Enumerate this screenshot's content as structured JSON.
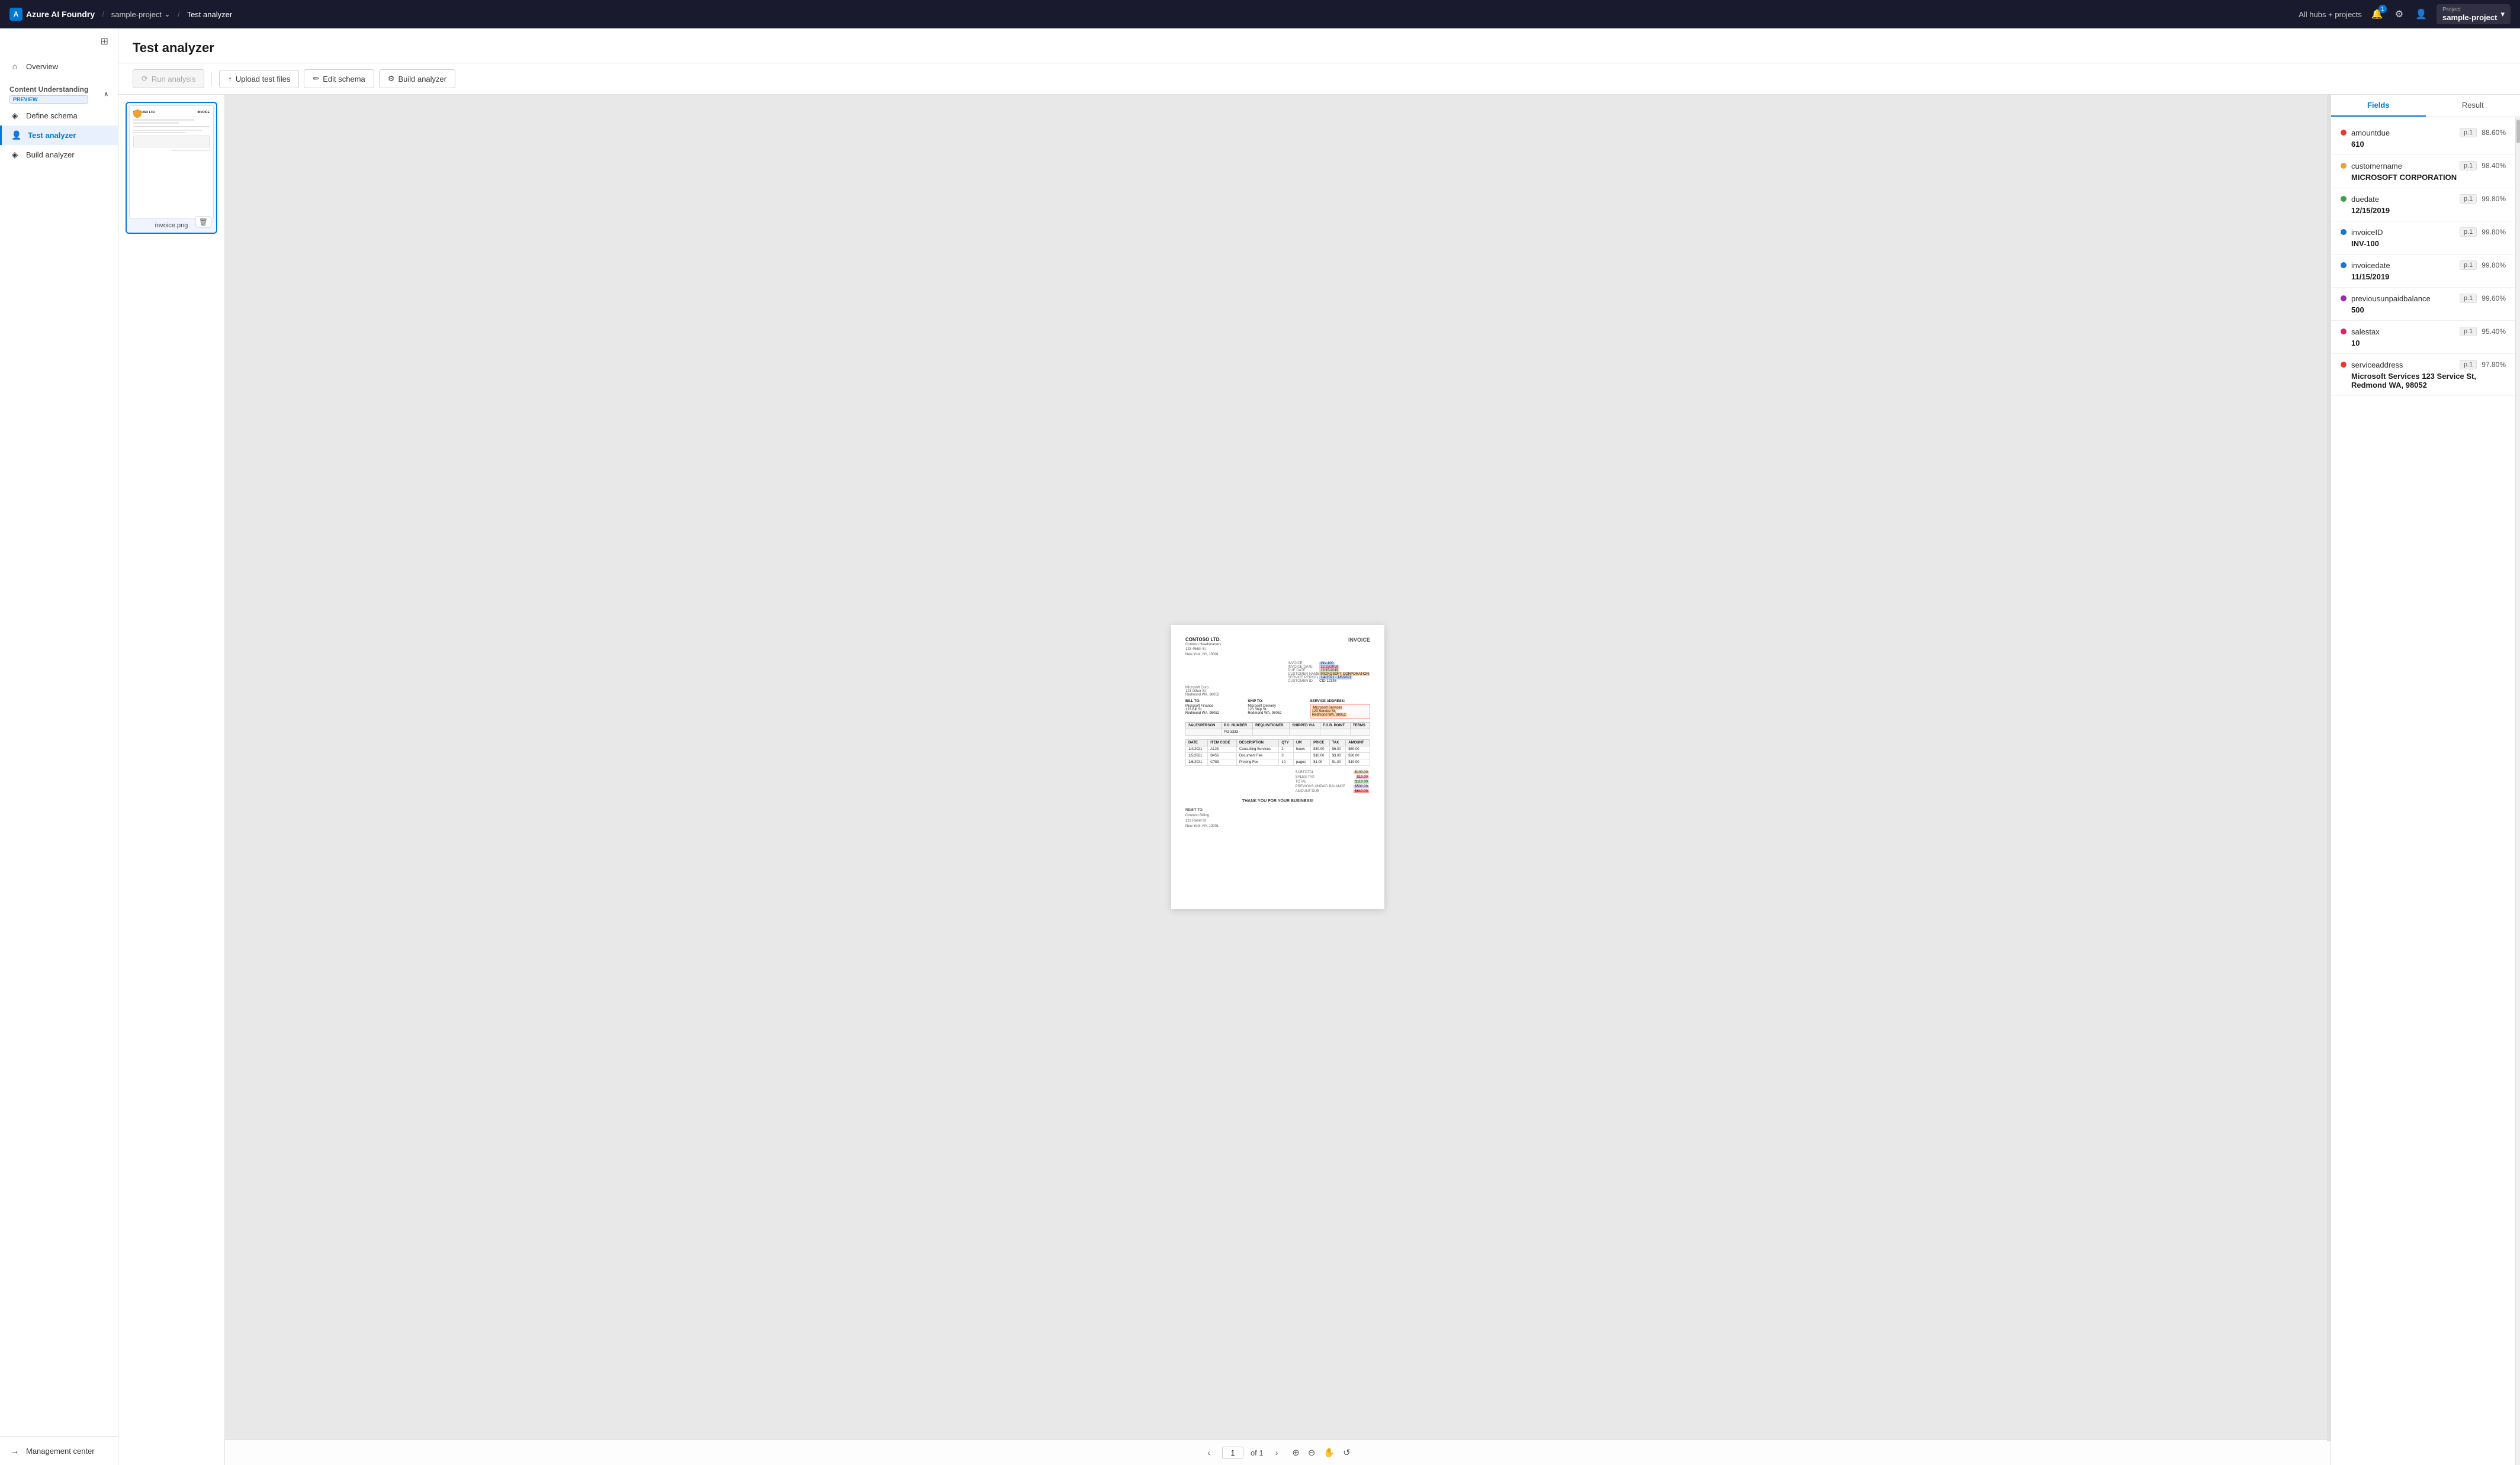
{
  "topnav": {
    "brand": "Azure AI Foundry",
    "brand_icon": "A",
    "project_link": "sample-project",
    "current_page": "Test analyzer",
    "hub_label": "All hubs + projects",
    "project_section_label": "Project",
    "project_name": "sample-project",
    "chevron_icon": "▾"
  },
  "sidebar": {
    "toggle_icon": "⊞",
    "overview_icon": "⌂",
    "overview_label": "Overview",
    "group_label": "Content Understanding",
    "group_preview": "PREVIEW",
    "expand_icon": "∧",
    "items": [
      {
        "id": "define-schema",
        "icon": "◈",
        "label": "Define schema",
        "active": false
      },
      {
        "id": "test-analyzer",
        "icon": "👤",
        "label": "Test analyzer",
        "active": true
      },
      {
        "id": "build-analyzer",
        "icon": "◈",
        "label": "Build analyzer",
        "active": false
      }
    ],
    "management_icon": "→",
    "management_label": "Management center"
  },
  "page": {
    "title": "Test analyzer"
  },
  "toolbar": {
    "run_analysis_label": "Run analysis",
    "run_analysis_icon": "⟳",
    "upload_files_label": "Upload test files",
    "upload_files_icon": "↑",
    "edit_schema_label": "Edit schema",
    "edit_schema_icon": "✏",
    "build_analyzer_label": "Build analyzer",
    "build_analyzer_icon": "⚙"
  },
  "file_panel": {
    "file_name": "invoice.png",
    "delete_icon": "🗑"
  },
  "preview": {
    "page_number": "1",
    "page_of": "of 1",
    "nav_prev_icon": "‹",
    "nav_next_icon": "›",
    "zoom_in_icon": "⊕",
    "zoom_out_icon": "⊖",
    "hand_icon": "✋",
    "rotate_icon": "↺",
    "invoice": {
      "company": "CONTOSO LTD.",
      "title": "INVOICE",
      "hq_label": "Contoso Headquarters",
      "hq_address": "123 456th St\nNew York, NY, 10001",
      "invoice_no_label": "INVOICE",
      "invoice_no": "INV-100",
      "invoice_date_label": "INVOICE DATE",
      "invoice_date": "11/15/2019",
      "due_date_label": "DUE DATE",
      "due_date": "12/15/2019",
      "customer_name_label": "CUSTOMER NAME",
      "customer_name": "MICROSOFT CORPORATION",
      "service_period_label": "SERVICE PERIOD",
      "service_period": "1/4/2021 - 1/6/2021",
      "customer_id_label": "CUSTOMER ID",
      "customer_id": "CID-12345",
      "bill_to_label": "BILL TO:",
      "bill_to": "Microsoft Finance\n123 Bill St.\nRedmond WA, 98052",
      "ship_to_label": "SHIP TO:",
      "ship_to": "Microsoft Delivery\n123 Ship St.\nRedmond WA, 98052",
      "service_address_label": "SERVICE ADDRESS:",
      "service_address": "Microsoft Services 123 Service St,\nRedmond WA, 98052",
      "salesperson_col": "SALESPERSON",
      "po_number_col": "P.O. NUMBER",
      "requisitioner_col": "REQUISITIONER",
      "shipped_via_col": "SHIPPED VIA",
      "fob_point_col": "F.O.B. POINT",
      "terms_col": "TERMS",
      "po_number": "PO-3333",
      "line_items": [
        {
          "date": "1/4/2021",
          "item_code": "A123",
          "description": "Consulting Services",
          "qty": "2",
          "um": "hours",
          "price": "$30.00",
          "tax": "$6.00",
          "amount": "$60.00"
        },
        {
          "date": "1/5/2021",
          "item_code": "B456",
          "description": "Document Fee",
          "qty": "3",
          "um": "",
          "price": "$10.00",
          "tax": "$3.00",
          "amount": "$30.00"
        },
        {
          "date": "1/6/2021",
          "item_code": "C789",
          "description": "Printing Fee",
          "qty": "10",
          "um": "pages",
          "price": "$1.00",
          "tax": "$1.00",
          "amount": "$10.00"
        }
      ],
      "subtotal_label": "SUBTOTAL",
      "subtotal": "$100.00",
      "sales_tax_label": "SALES TAX",
      "sales_tax": "$10.00",
      "total_label": "TOTAL",
      "total": "$110.00",
      "prev_unpaid_label": "PREVIOUS UNPAID BALANCE",
      "prev_unpaid": "$500.00",
      "amount_due_label": "AMOUNT DUE",
      "amount_due": "$610.00",
      "thank_you": "THANK YOU FOR YOUR BUSINESS!",
      "remit_to_label": "REMIT TO:",
      "remit_to": "Contoso Billing\n123 Remit St\nNew York, NY, 10001"
    }
  },
  "fields_panel": {
    "tab_fields": "Fields",
    "tab_result": "Result",
    "fields": [
      {
        "id": "amountdue",
        "name": "amountdue",
        "dot_color": "#e53935",
        "page": "p.1",
        "confidence": "88.60%",
        "value": "610"
      },
      {
        "id": "customername",
        "name": "customername",
        "dot_color": "#f0a030",
        "page": "p.1",
        "confidence": "98.40%",
        "value": "MICROSOFT CORPORATION"
      },
      {
        "id": "duedate",
        "name": "duedate",
        "dot_color": "#43a047",
        "page": "p.1",
        "confidence": "99.80%",
        "value": "12/15/2019"
      },
      {
        "id": "invoiceID",
        "name": "invoiceID",
        "dot_color": "#1976d2",
        "page": "p.1",
        "confidence": "99.80%",
        "value": "INV-100"
      },
      {
        "id": "invoicedate",
        "name": "invoicedate",
        "dot_color": "#1976d2",
        "page": "p.1",
        "confidence": "99.80%",
        "value": "11/15/2019"
      },
      {
        "id": "previousunpaidbalance",
        "name": "previousunpaidbalance",
        "dot_color": "#9c27b0",
        "page": "p.1",
        "confidence": "99.60%",
        "value": "500"
      },
      {
        "id": "salestax",
        "name": "salestax",
        "dot_color": "#e91e63",
        "page": "p.1",
        "confidence": "95.40%",
        "value": "10"
      },
      {
        "id": "serviceaddress",
        "name": "serviceaddress",
        "dot_color": "#e53935",
        "page": "p.1",
        "confidence": "97.80%",
        "value": "Microsoft Services 123 Service St, Redmond WA, 98052"
      }
    ]
  }
}
